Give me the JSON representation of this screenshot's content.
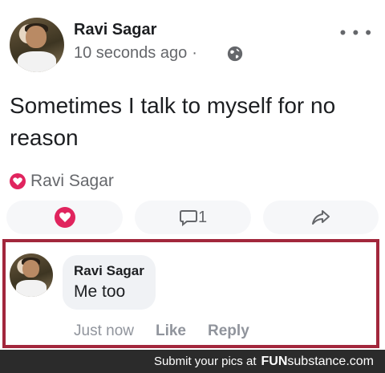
{
  "post": {
    "author": "Ravi Sagar",
    "timestamp": "10 seconds ago",
    "separator": "·",
    "privacy_icon": "globe-icon",
    "more_icon": "more-icon",
    "text": "Sometimes I talk to myself for no reason",
    "reaction_by": "Ravi Sagar",
    "comment_count": "1"
  },
  "comment": {
    "author": "Ravi Sagar",
    "text": "Me too",
    "time": "Just now",
    "like_label": "Like",
    "reply_label": "Reply"
  },
  "footer": {
    "prefix": "Submit your pics at",
    "brand_bold": "FUN",
    "brand_rest": "substance.com"
  },
  "colors": {
    "highlight_border": "#a2273c",
    "love_red": "#e0245e",
    "meta_gray": "#65676b"
  }
}
